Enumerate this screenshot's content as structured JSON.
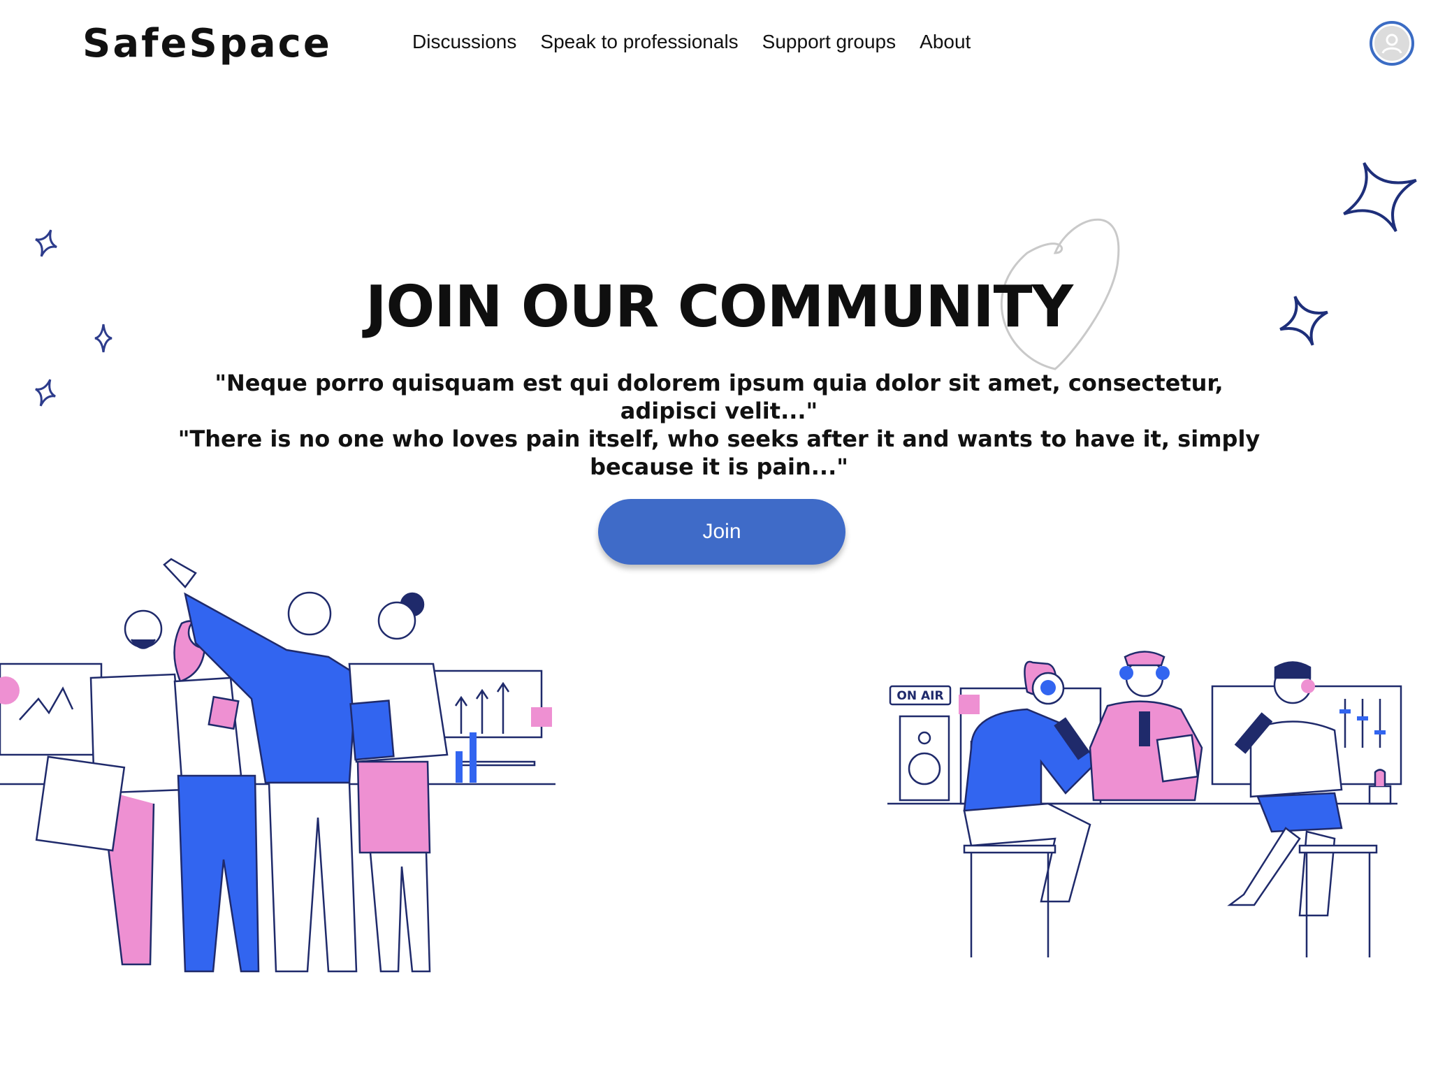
{
  "header": {
    "logo": "SafeSpace",
    "nav": [
      {
        "label": "Discussions"
      },
      {
        "label": "Speak to professionals"
      },
      {
        "label": "Support groups"
      },
      {
        "label": "About"
      }
    ],
    "avatar_icon": "user-avatar-icon"
  },
  "hero": {
    "title": "JOIN OUR COMMUNITY",
    "quote_lines": [
      "\"Neque porro quisquam est qui dolorem ipsum quia dolor sit amet, consectetur, adipisci velit...\"",
      "\"There is no one who loves pain itself, who seeks after it and wants to have it, simply because it is pain...\""
    ],
    "join_label": "Join"
  },
  "illustrations": {
    "studio_sign": "ON AIR"
  },
  "colors": {
    "accent_blue": "#3f6bc8",
    "illustration_blue": "#3265f0",
    "illustration_pink": "#ee90d2",
    "outline_navy": "#1f2a6b"
  }
}
